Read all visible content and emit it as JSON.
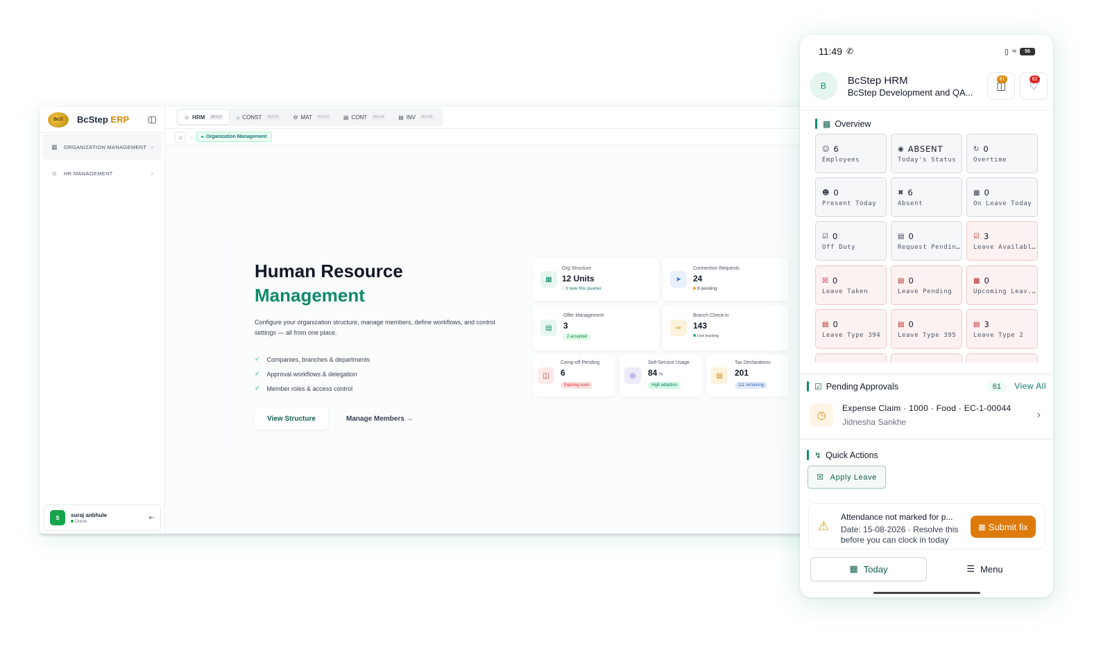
{
  "desktop": {
    "brand": {
      "logo_text": "BcS",
      "name": "BcStep",
      "suffix": "ERP"
    },
    "sidebar": {
      "items": [
        {
          "label": "ORGANIZATION MANAGEMENT",
          "icon": "building-icon"
        },
        {
          "label": "HR MANAGEMENT",
          "icon": "users-icon"
        }
      ]
    },
    "user": {
      "initial": "S",
      "name": "suraj anbhule",
      "status": "Online"
    },
    "tabs": [
      {
        "label": "HRM",
        "shortcut": "Alt+1",
        "icon": "users-icon"
      },
      {
        "label": "CONST",
        "shortcut": "Alt+2",
        "icon": "house-icon"
      },
      {
        "label": "MAT",
        "shortcut": "Alt+3",
        "icon": "gear-icon"
      },
      {
        "label": "CONT",
        "shortcut": "Alt+4",
        "icon": "document-icon"
      },
      {
        "label": "INV",
        "shortcut": "Alt+5",
        "icon": "document-icon"
      }
    ],
    "breadcrumb": {
      "current": "Organization Management"
    },
    "hero": {
      "title_line1": "Human Resource",
      "title_line2": "Management",
      "description": "Configure your organization structure, manage members, define workflows, and control settings — all from one place.",
      "checklist": [
        "Companies, branches & departments",
        "Approval workflows & delegation",
        "Member roles & access control"
      ],
      "primary_button": "View Structure",
      "secondary_button": "Manage Members →"
    },
    "stats": {
      "org": {
        "label": "Org Structure",
        "value": "12 Units",
        "sub": "↑ 3 new this quarter"
      },
      "conn": {
        "label": "Connection Requests",
        "value": "24",
        "sub": "8 pending"
      },
      "offer": {
        "label": "Offer Management",
        "value": "3",
        "sub": "2 accepted"
      },
      "branch": {
        "label": "Branch Check-in",
        "value": "143",
        "sub": "Live tracking"
      },
      "comp": {
        "label": "Comp-off Pending",
        "value": "6",
        "sub": "Expiring soon"
      },
      "self": {
        "label": "Self-Service Usage",
        "value": "84",
        "unit": "%",
        "sub": "High adoption"
      },
      "tax": {
        "label": "Tax Declarations",
        "value": "201",
        "sub": "111 remaining"
      }
    },
    "colors": {
      "accent": "#0f8a6a",
      "brand_gold": "#d38b0a"
    }
  },
  "phone": {
    "time": "11:49",
    "battery": "56",
    "avatar_initial": "B",
    "app_title": "BcStep HRM",
    "app_subtitle": "BcStep Development and QA...",
    "badges": {
      "approvals": "61",
      "notifications": "62"
    },
    "overview": {
      "title": "Overview",
      "tiles": [
        {
          "value": "6",
          "label": "Employees",
          "icon": "users-icon"
        },
        {
          "value": "ABSENT",
          "label": "Today's Status",
          "icon": "fingerprint-icon"
        },
        {
          "value": "0",
          "label": "Overtime",
          "icon": "clock-icon"
        },
        {
          "value": "0",
          "label": "Present Today",
          "icon": "user-check-icon"
        },
        {
          "value": "6",
          "label": "Absent",
          "icon": "user-x-icon"
        },
        {
          "value": "0",
          "label": "On Leave Today",
          "icon": "calendar-icon"
        },
        {
          "value": "0",
          "label": "Off Duty",
          "icon": "calendar-check-icon"
        },
        {
          "value": "0",
          "label": "Request Pending",
          "icon": "document-clock-icon"
        },
        {
          "value": "3",
          "label": "Leave Available",
          "icon": "calendar-check-icon"
        },
        {
          "value": "0",
          "label": "Leave Taken",
          "icon": "calendar-x-icon"
        },
        {
          "value": "0",
          "label": "Leave Pending",
          "icon": "document-clock-icon"
        },
        {
          "value": "0",
          "label": "Upcoming Leav...",
          "icon": "calendar-icon"
        },
        {
          "value": "0",
          "label": "Leave Type 394",
          "icon": "calendar-list-icon"
        },
        {
          "value": "0",
          "label": "Leave Type 395",
          "icon": "calendar-list-icon"
        },
        {
          "value": "3",
          "label": "Leave Type 2",
          "icon": "calendar-list-icon"
        }
      ]
    },
    "pending": {
      "title": "Pending Approvals",
      "count": "61",
      "view_all": "View All",
      "item_title": "Expense Claim · 1000 · Food · EC-1-00044",
      "item_sub": "Jidnesha Sankhe"
    },
    "quick_actions": {
      "title": "Quick Actions",
      "apply_leave": "Apply Leave"
    },
    "alert": {
      "title": "Attendance not marked for p...",
      "body": "Date: 15-08-2026 · Resolve this before you can clock in today",
      "button": "Submit fix"
    },
    "nav": {
      "today": "Today",
      "menu": "Menu"
    }
  }
}
